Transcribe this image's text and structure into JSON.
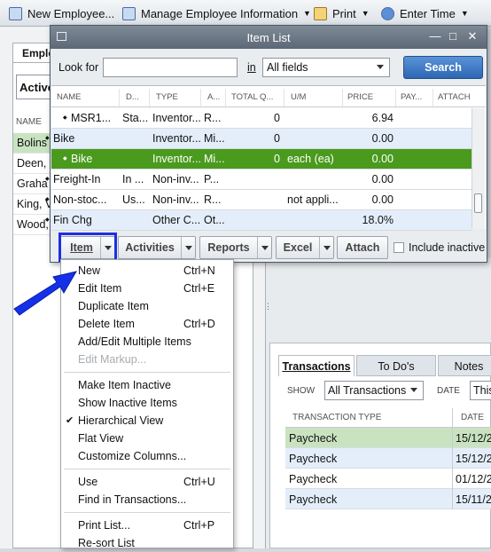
{
  "toolbar": {
    "new_employee": "New Employee...",
    "manage_info": "Manage Employee Information",
    "print": "Print",
    "enter_time": "Enter Time"
  },
  "employees_panel": {
    "tab": "Emplo",
    "filter": "Active",
    "name_header": "NAME",
    "rows": [
      "Bolins",
      "Deen,",
      "Graha",
      "King, V",
      "Wood,"
    ]
  },
  "window": {
    "title": "Item List",
    "look_for_label": "Look for",
    "look_for_value": "",
    "in_label": "in",
    "in_field": "All fields",
    "search": "Search"
  },
  "table": {
    "headers": [
      "NAME",
      "D...",
      "TYPE",
      "A...",
      "TOTAL Q...",
      "U/M",
      "PRICE",
      "PAY...",
      "ATTACH"
    ],
    "rows": [
      {
        "name": "MSR1...",
        "desc": "Sta...",
        "type": "Inventor...",
        "acct": "R...",
        "qty": "0",
        "um": "",
        "price": "6.94",
        "style": "white",
        "indent": 1
      },
      {
        "name": "Bike",
        "desc": "",
        "type": "Inventor...",
        "acct": "Mi...",
        "qty": "0",
        "um": "",
        "price": "0.00",
        "style": "blue",
        "indent": 0
      },
      {
        "name": "Bike",
        "desc": "",
        "type": "Inventor...",
        "acct": "Mi...",
        "qty": "0",
        "um": "each (ea)",
        "price": "0.00",
        "style": "green",
        "indent": 1
      },
      {
        "name": "Freight-In",
        "desc": "In ...",
        "type": "Non-inv...",
        "acct": "P...",
        "qty": "",
        "um": "",
        "price": "0.00",
        "style": "white",
        "indent": 0
      },
      {
        "name": "Non-stoc...",
        "desc": "Us...",
        "type": "Non-inv...",
        "acct": "R...",
        "qty": "",
        "um": "not appli...",
        "price": "0.00",
        "style": "white",
        "indent": 0
      },
      {
        "name": "Fin Chg",
        "desc": "",
        "type": "Other C...",
        "acct": "Ot...",
        "qty": "",
        "um": "",
        "price": "18.0%",
        "style": "blue",
        "indent": 0
      }
    ]
  },
  "bottom_buttons": {
    "item": "Item",
    "activities": "Activities",
    "reports": "Reports",
    "excel": "Excel",
    "attach": "Attach",
    "include_inactive": "Include inactive"
  },
  "menu": {
    "items": [
      {
        "label": "New",
        "shortcut": "Ctrl+N",
        "disabled": false
      },
      {
        "label": "Edit Item",
        "shortcut": "Ctrl+E",
        "disabled": false
      },
      {
        "label": "Duplicate Item",
        "shortcut": "",
        "disabled": false
      },
      {
        "label": "Delete Item",
        "shortcut": "Ctrl+D",
        "disabled": false
      },
      {
        "label": "Add/Edit Multiple Items",
        "shortcut": "",
        "disabled": false
      },
      {
        "label": "Edit Markup...",
        "shortcut": "",
        "disabled": true
      },
      {
        "label": "Make Item Inactive",
        "shortcut": "",
        "disabled": false
      },
      {
        "label": "Show Inactive Items",
        "shortcut": "",
        "disabled": false
      },
      {
        "label": "Hierarchical View",
        "shortcut": "",
        "disabled": false,
        "checked": true
      },
      {
        "label": "Flat View",
        "shortcut": "",
        "disabled": false
      },
      {
        "label": "Customize Columns...",
        "shortcut": "",
        "disabled": false
      },
      {
        "label": "Use",
        "shortcut": "Ctrl+U",
        "disabled": false
      },
      {
        "label": "Find in Transactions...",
        "shortcut": "",
        "disabled": false
      },
      {
        "label": "Print List...",
        "shortcut": "Ctrl+P",
        "disabled": false
      },
      {
        "label": "Re-sort List",
        "shortcut": "",
        "disabled": false
      }
    ]
  },
  "transactions": {
    "tabs": [
      "Transactions",
      "To Do's",
      "Notes"
    ],
    "show_label": "SHOW",
    "show_value": "All Transactions",
    "date_label": "DATE",
    "date_value": "This",
    "headers": [
      "TRANSACTION TYPE",
      "DATE"
    ],
    "rows": [
      {
        "type": "Paycheck",
        "date": "15/12/2"
      },
      {
        "type": "Paycheck",
        "date": "15/12/2"
      },
      {
        "type": "Paycheck",
        "date": "01/12/2"
      },
      {
        "type": "Paycheck",
        "date": "15/11/2"
      }
    ]
  },
  "colors": {
    "selected_row": "#4a9a1e",
    "alt_row": "#e4eefb",
    "search_blue": "#2d66b4",
    "highlight_border": "#1d2fe2"
  }
}
